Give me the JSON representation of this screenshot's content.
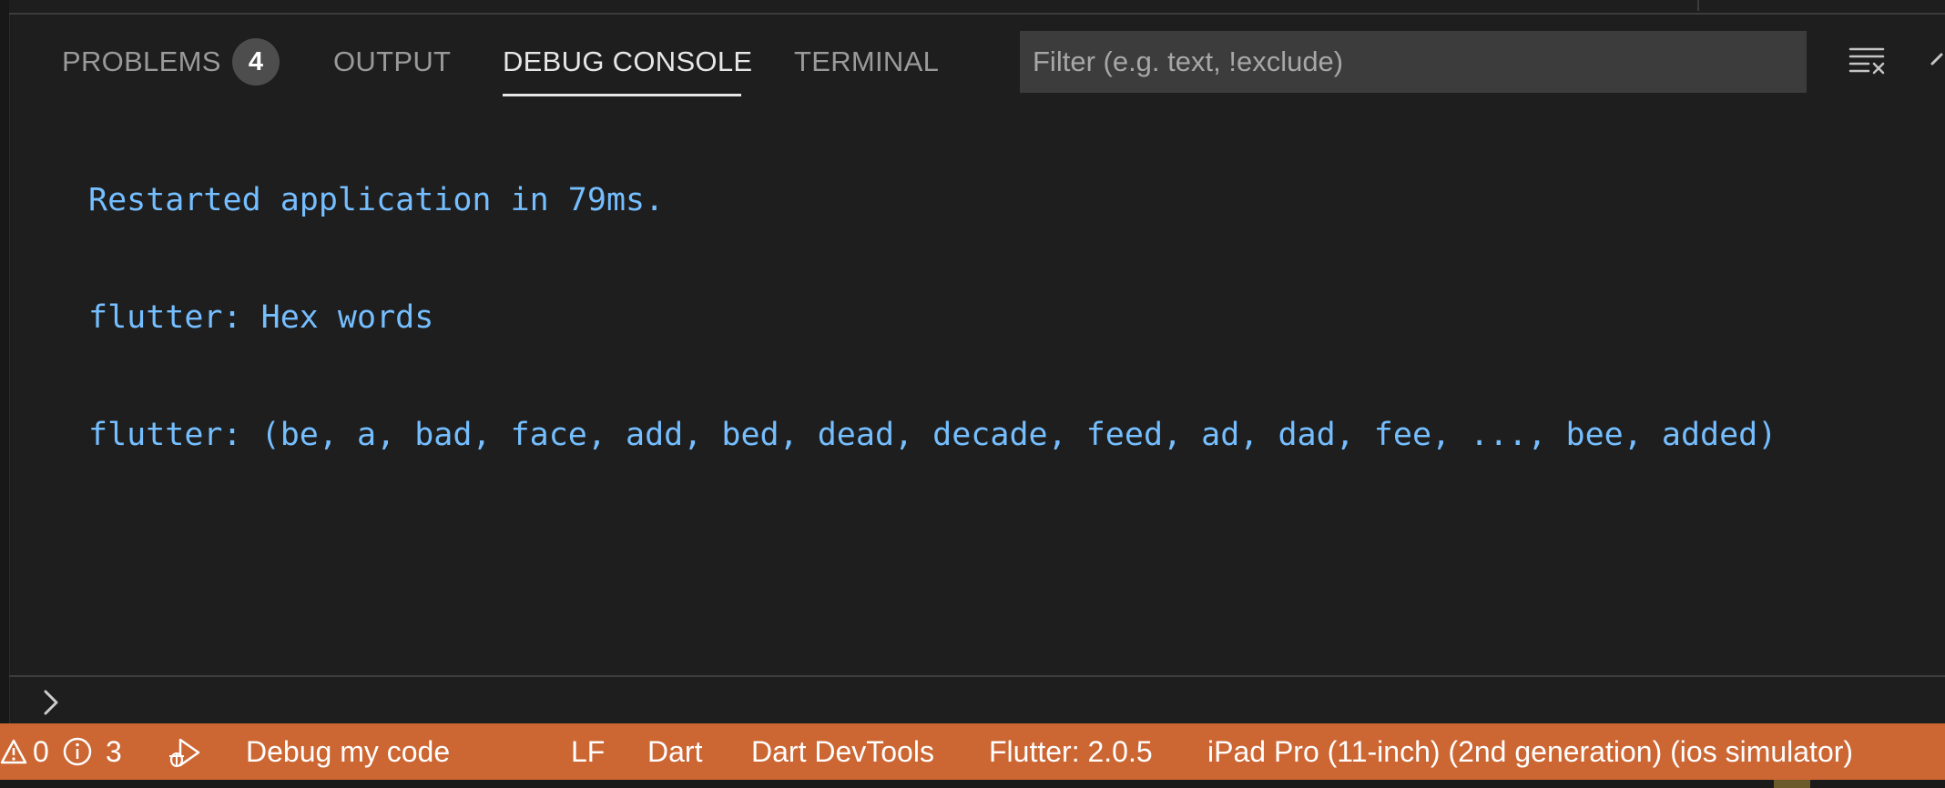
{
  "panel": {
    "tabs": [
      {
        "label": "PROBLEMS",
        "badge": "4"
      },
      {
        "label": "OUTPUT"
      },
      {
        "label": "DEBUG CONSOLE",
        "active": true
      },
      {
        "label": "TERMINAL"
      }
    ],
    "filter_placeholder": "Filter (e.g. text, !exclude)",
    "clear_icon": "clear-console-icon",
    "collapse_icon": "chevron-up-icon"
  },
  "console": {
    "lines": [
      "Restarted application in 79ms.",
      "flutter: Hex words",
      "flutter: (be, a, bad, face, add, bed, dead, decade, feed, ad, dad, fee, ..., bee, added)"
    ],
    "text_color": "#75beff",
    "prompt_icon": "chevron-right-icon"
  },
  "statusbar": {
    "background": "#cc6633",
    "warnings_count": "0",
    "info_count": "3",
    "debug_label": "Debug my code",
    "eol": "LF",
    "language": "Dart",
    "devtools": "Dart DevTools",
    "flutter_version": "Flutter: 2.0.5",
    "device": "iPad Pro (11-inch) (2nd generation) (ios simulator)"
  }
}
